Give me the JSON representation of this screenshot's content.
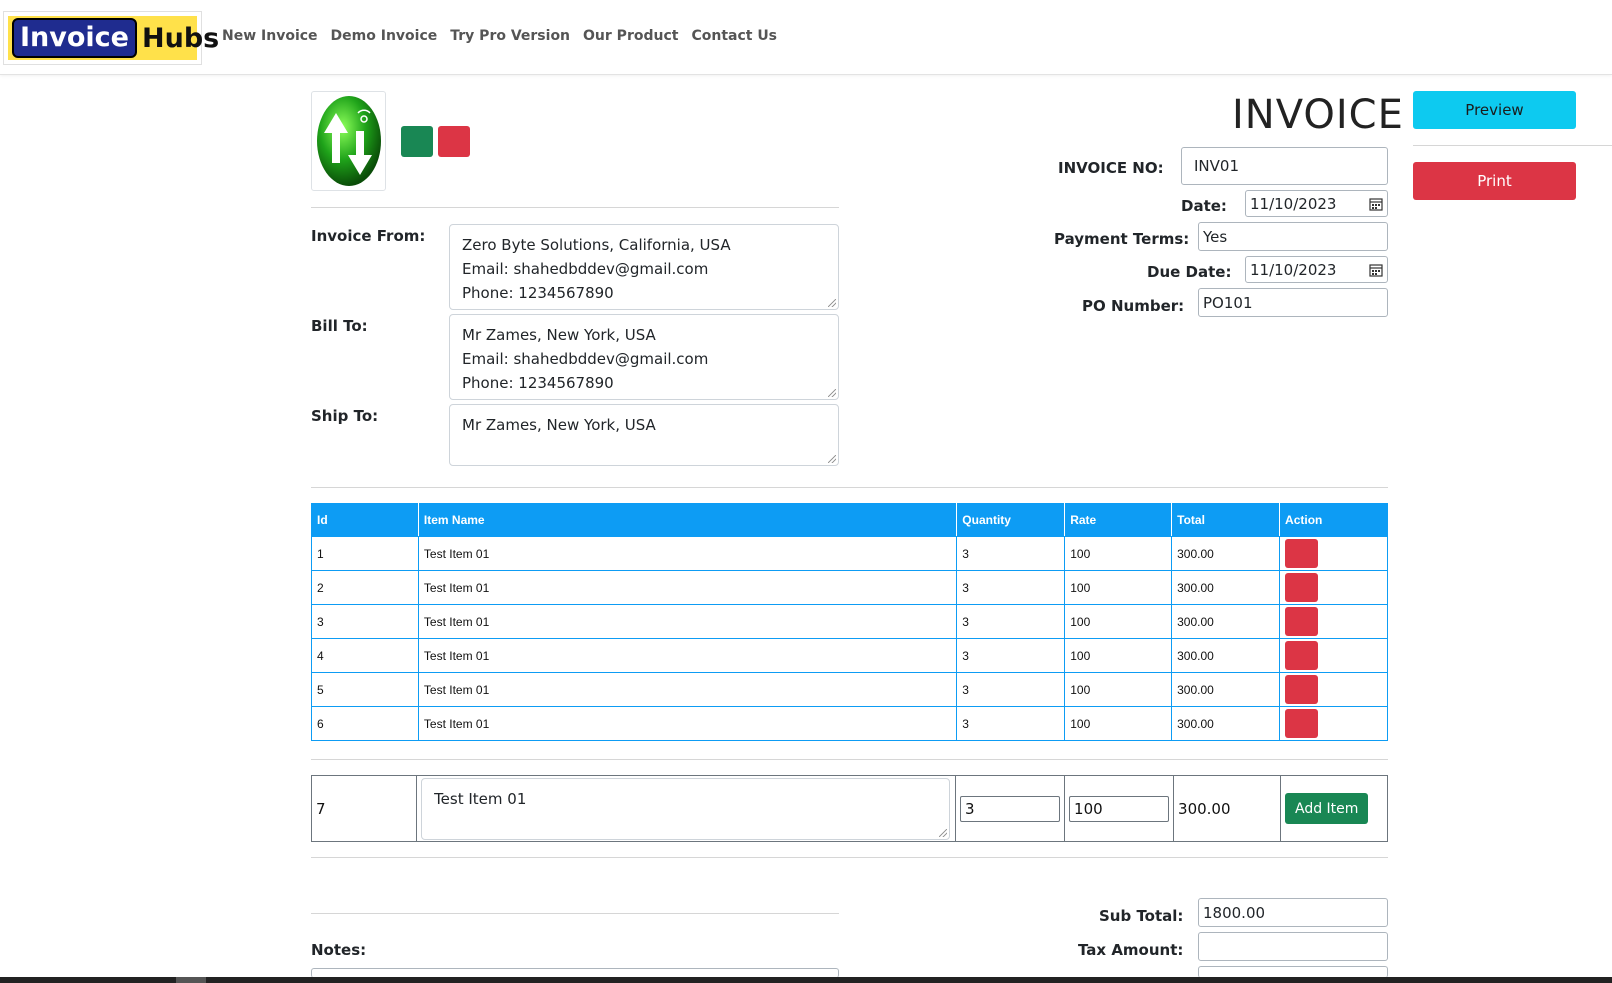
{
  "brand": {
    "part1": "Invoice",
    "part2": "Hubs"
  },
  "nav": [
    {
      "label": "New Invoice"
    },
    {
      "label": "Demo Invoice"
    },
    {
      "label": "Try Pro Version"
    },
    {
      "label": "Our Product"
    },
    {
      "label": "Contact Us"
    }
  ],
  "colors": {
    "green": "#198754",
    "red": "#dc3545",
    "table_header": "#0d9cf4",
    "preview": "#0dcaf0"
  },
  "form": {
    "invoice_from_label": "Invoice From:",
    "invoice_from": [
      "Zero Byte Solutions, California, USA",
      "Email: shahedbddev@gmail.com",
      "Phone: 1234567890"
    ],
    "bill_to_label": "Bill To:",
    "bill_to": [
      "Mr Zames, New York, USA",
      "Email: shahedbddev@gmail.com",
      "Phone: 1234567890"
    ],
    "ship_to_label": "Ship To:",
    "ship_to": [
      "Mr Zames, New York, USA"
    ]
  },
  "header": {
    "title": "INVOICE",
    "invoice_no_label": "INVOICE NO:",
    "invoice_no": "INV01",
    "date_label": "Date:",
    "date": "11/10/2023",
    "payment_terms_label": "Payment Terms:",
    "payment_terms": "Yes",
    "due_date_label": "Due Date:",
    "due_date": "11/10/2023",
    "po_label": "PO Number:",
    "po": "PO101"
  },
  "actions": {
    "preview": "Preview",
    "print": "Print"
  },
  "table": {
    "headers": [
      "Id",
      "Item Name",
      "Quantity",
      "Rate",
      "Total",
      "Action"
    ],
    "rows": [
      {
        "id": "1",
        "name": "Test Item 01",
        "qty": "3",
        "rate": "100",
        "total": "300.00"
      },
      {
        "id": "2",
        "name": "Test Item 01",
        "qty": "3",
        "rate": "100",
        "total": "300.00"
      },
      {
        "id": "3",
        "name": "Test Item 01",
        "qty": "3",
        "rate": "100",
        "total": "300.00"
      },
      {
        "id": "4",
        "name": "Test Item 01",
        "qty": "3",
        "rate": "100",
        "total": "300.00"
      },
      {
        "id": "5",
        "name": "Test Item 01",
        "qty": "3",
        "rate": "100",
        "total": "300.00"
      },
      {
        "id": "6",
        "name": "Test Item 01",
        "qty": "3",
        "rate": "100",
        "total": "300.00"
      }
    ]
  },
  "new_item": {
    "id": "7",
    "name": "Test Item 01",
    "qty": "3",
    "rate": "100",
    "total": "300.00",
    "add_label": "Add Item"
  },
  "totals": {
    "subtotal_label": "Sub Total:",
    "subtotal": "1800.00",
    "tax_label": "Tax Amount:",
    "tax": ""
  },
  "notes": {
    "label": "Notes:"
  }
}
